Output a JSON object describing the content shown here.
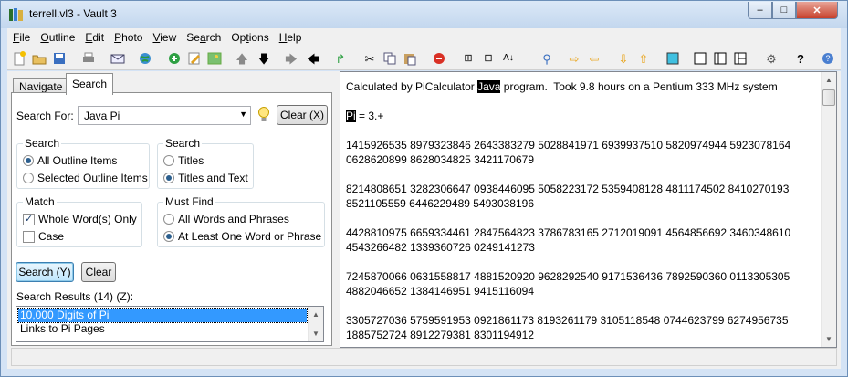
{
  "window": {
    "title": "terrell.vl3 - Vault 3",
    "controls": {
      "minimize": "–",
      "maximize": "□",
      "close": "✕"
    }
  },
  "menu": [
    {
      "prefix": "",
      "mnemonic": "F",
      "rest": "ile"
    },
    {
      "prefix": "",
      "mnemonic": "O",
      "rest": "utline"
    },
    {
      "prefix": "",
      "mnemonic": "E",
      "rest": "dit"
    },
    {
      "prefix": "",
      "mnemonic": "P",
      "rest": "hoto"
    },
    {
      "prefix": "",
      "mnemonic": "V",
      "rest": "iew"
    },
    {
      "prefix": "Se",
      "mnemonic": "a",
      "rest": "rch"
    },
    {
      "prefix": "Op",
      "mnemonic": "t",
      "rest": "ions"
    },
    {
      "prefix": "",
      "mnemonic": "H",
      "rest": "elp"
    }
  ],
  "toolbar_icons": [
    "new-icon",
    "open-icon",
    "save-icon",
    "print-icon",
    "email-icon",
    "globe-icon",
    "add-icon",
    "edit-icon",
    "picture-icon",
    "up-gray-icon",
    "down-icon",
    "right-gray-icon",
    "left-icon",
    "redo-icon",
    "cut-icon",
    "copy-icon",
    "paste-icon",
    "delete-icon",
    "expand-icon",
    "collapse-icon",
    "sort-icon",
    "find-icon",
    "indent-icon",
    "outdent-icon",
    "move-down-icon",
    "move-up-icon",
    "focus-icon",
    "single-pane-icon",
    "two-pane-icon",
    "three-pane-icon",
    "settings-icon",
    "help-icon",
    "info-icon"
  ],
  "tabs": {
    "navigate": "Navigate",
    "search": "Search"
  },
  "search": {
    "search_for_label": "Search For:",
    "query": "Java Pi",
    "clear_x_label": "Clear (X)",
    "search_group": {
      "title": "Search",
      "all_items": "All Outline Items",
      "selected_items": "Selected Outline Items",
      "selected": "all_items"
    },
    "search_in_group": {
      "title": "Search",
      "titles": "Titles",
      "titles_and_text": "Titles and Text",
      "selected": "titles_and_text"
    },
    "match_group": {
      "title": "Match",
      "whole_words": "Whole Word(s) Only",
      "whole_words_checked": true,
      "case": "Case",
      "case_checked": false
    },
    "must_find_group": {
      "title": "Must Find",
      "all_words": "All Words and Phrases",
      "at_least_one": "At Least One Word or Phrase",
      "selected": "at_least_one"
    },
    "search_button": "Search (Y)",
    "clear_button": "Clear",
    "results_label": "Search Results (14) (Z):",
    "results": [
      "10,000 Digits of Pi",
      "Links to Pi Pages"
    ],
    "selected_result": 0
  },
  "editor": {
    "line1_before": "Calculated by PiCalculator ",
    "line1_highlight": "Java",
    "line1_after": " program.  Took 9.8 hours on a Pentium 333 MHz system",
    "line2_highlight": "Pi",
    "line2_after": " = 3.+",
    "digit_lines": [
      "",
      "1415926535 8979323846 2643383279 5028841971 6939937510 5820974944 5923078164",
      "0628620899 8628034825 3421170679",
      "",
      "8214808651 3282306647 0938446095 5058223172 5359408128 4811174502 8410270193",
      "8521105559 6446229489 5493038196",
      "",
      "4428810975 6659334461 2847564823 3786783165 2712019091 4564856692 3460348610",
      "4543266482 1339360726 0249141273",
      "",
      "7245870066 0631558817 4881520920 9628292540 9171536436 7892590360 0113305305",
      "4882046652 1384146951 9415116094",
      "",
      "3305727036 5759591953 0921861173 8193261179 3105118548 0744623799 6274956735",
      "1885752724 8912279381 8301194912"
    ]
  }
}
